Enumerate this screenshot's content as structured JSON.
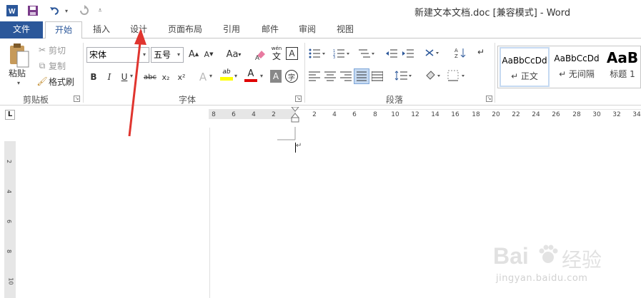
{
  "window": {
    "title": "新建文本文档.doc [兼容模式] - Word"
  },
  "quick_access": {
    "app_icon": "word-icon",
    "save_icon": "save-icon",
    "undo_icon": "undo-icon",
    "redo_icon": "redo-icon",
    "customize_icon": "customize-icon"
  },
  "tabs": [
    {
      "label": "文件"
    },
    {
      "label": "开始"
    },
    {
      "label": "插入"
    },
    {
      "label": "设计"
    },
    {
      "label": "页面布局"
    },
    {
      "label": "引用"
    },
    {
      "label": "邮件"
    },
    {
      "label": "审阅"
    },
    {
      "label": "视图"
    }
  ],
  "clipboard": {
    "paste": "粘贴",
    "cut": "剪切",
    "copy": "复制",
    "format_painter": "格式刷",
    "group_label": "剪贴板"
  },
  "font": {
    "font_name": "宋体",
    "font_size": "五号",
    "change_case": "Aa",
    "phonetic_top": "wén",
    "phonetic_char": "文",
    "bordered_char": "A",
    "bold": "B",
    "italic": "I",
    "underline": "U",
    "strike": "abc",
    "subscript": "x₂",
    "superscript": "x²",
    "text_effect": "A",
    "highlight": "ab",
    "font_color": "A",
    "shading": "A",
    "enclosed_char": "字",
    "grow": "A",
    "shrink": "A",
    "group_label": "字体"
  },
  "paragraph": {
    "group_label": "段落"
  },
  "styles": {
    "items": [
      {
        "preview": "AaBbCcDd",
        "name": "↵ 正文"
      },
      {
        "preview": "AaBbCcDd",
        "name": "↵ 无间隔"
      },
      {
        "preview": "AaB",
        "name": "标题 1"
      }
    ]
  },
  "ruler": {
    "left_ticks": [
      "8",
      "6",
      "4",
      "2"
    ],
    "right_ticks": [
      "2",
      "4",
      "6",
      "8",
      "10",
      "12",
      "14",
      "16",
      "18",
      "20",
      "22",
      "24",
      "26",
      "28",
      "30",
      "32",
      "34"
    ],
    "vertical_ticks": [
      "2",
      "4",
      "6",
      "8",
      "10"
    ],
    "tab_selector": "L"
  },
  "document": {
    "paragraph_mark": "↵"
  },
  "watermark": {
    "brand": "Bai",
    "brand2": "经验",
    "url": "jingyan.baidu.com"
  },
  "colors": {
    "accent": "#2b579a",
    "annotation_arrow": "#e0352f",
    "highlight_yellow": "#ffff00",
    "font_red": "#e00000"
  }
}
